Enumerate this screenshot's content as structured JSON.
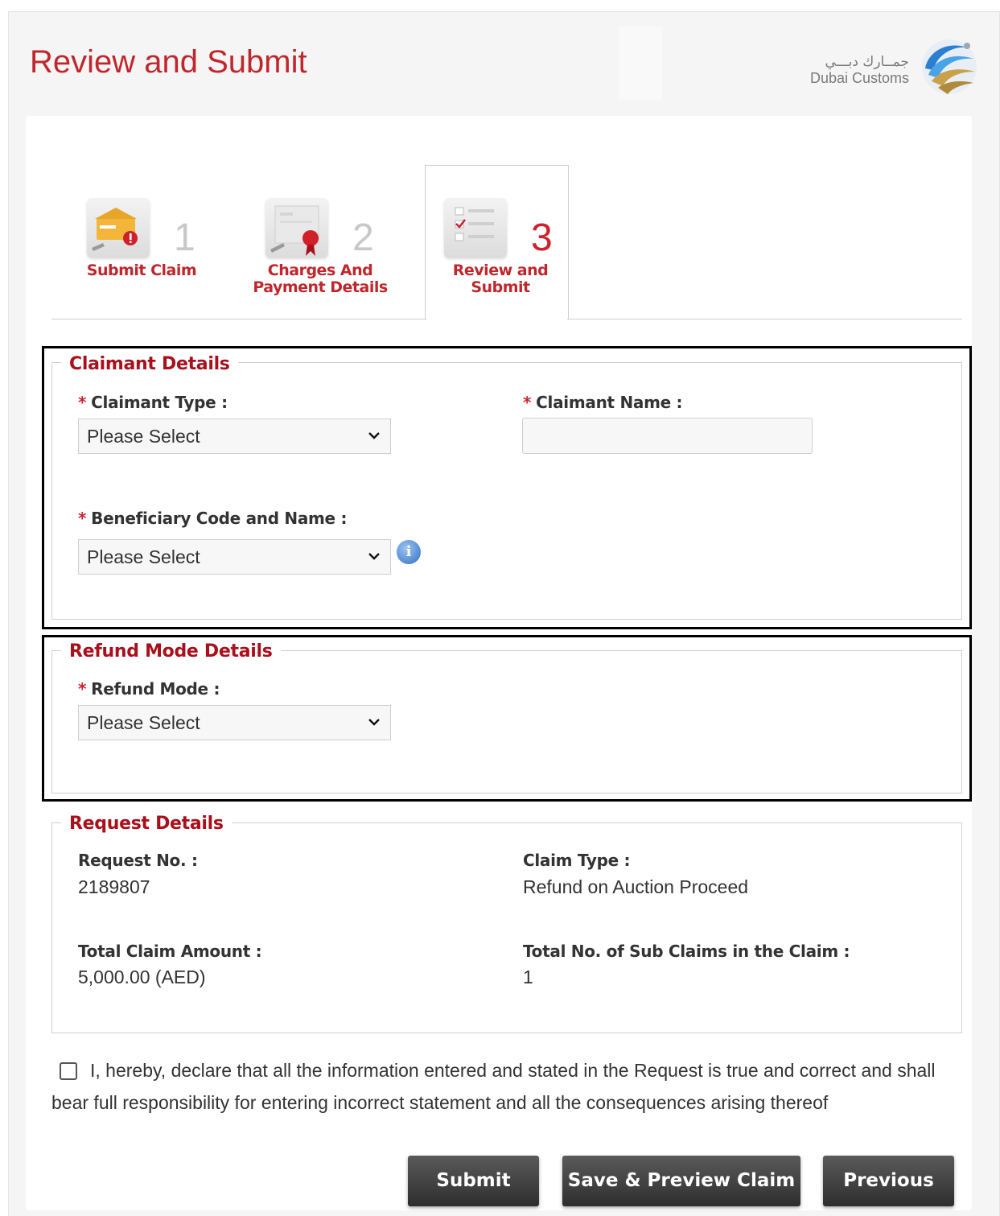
{
  "header": {
    "title": "Review and Submit",
    "logo_arabic": "جمــارك دبـــي",
    "logo_english": "Dubai Customs"
  },
  "steps": [
    {
      "number": "1",
      "label": "Submit Claim",
      "icon": "claim-folder-icon"
    },
    {
      "number": "2",
      "label": "Charges And Payment Details",
      "icon": "payment-seal-icon"
    },
    {
      "number": "3",
      "label": "Review and Submit",
      "icon": "checklist-icon",
      "active": true
    }
  ],
  "claimant": {
    "legend": "Claimant Details",
    "type_label": "Claimant Type :",
    "type_value": "Please Select",
    "name_label": "Claimant Name :",
    "name_value": "",
    "beneficiary_label": "Beneficiary Code and Name :",
    "beneficiary_value": "Please Select"
  },
  "refund": {
    "legend": "Refund Mode Details",
    "mode_label": "Refund Mode :",
    "mode_value": "Please Select"
  },
  "request": {
    "legend": "Request Details",
    "request_no_label": "Request No. :",
    "request_no_value": "2189807",
    "claim_type_label": "Claim Type :",
    "claim_type_value": "Refund on Auction Proceed",
    "total_amount_label": "Total Claim Amount :",
    "total_amount_value": "5,000.00 (AED)",
    "sub_claims_label": "Total No. of Sub Claims in the Claim :",
    "sub_claims_value": "1"
  },
  "declaration": "I, hereby, declare that all the information entered and stated in the Request is true and correct and shall bear full responsibility for entering incorrect statement and all the consequences arising thereof",
  "buttons": {
    "submit": "Submit",
    "save_preview": "Save & Preview Claim",
    "previous": "Previous"
  },
  "colors": {
    "accent_red": "#c0272d",
    "button_dark": "#3a3a3a"
  }
}
